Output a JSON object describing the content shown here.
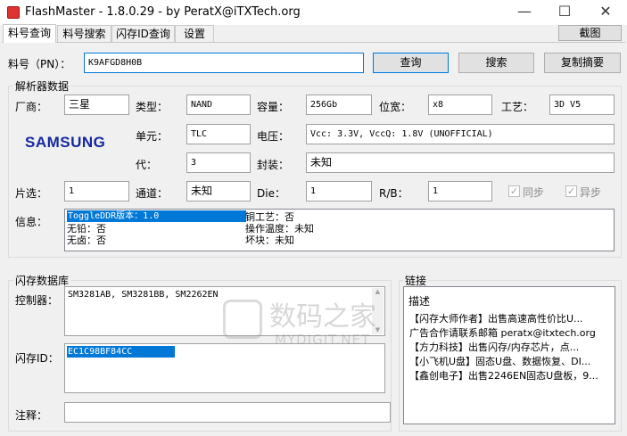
{
  "window": {
    "title": "FlashMaster - 1.8.0.29 - by PeratX@iTXTech.org",
    "minimize": "—",
    "maximize": "☐",
    "close": "✕"
  },
  "tabs": [
    "料号查询",
    "料号搜索",
    "闪存ID查询",
    "设置"
  ],
  "toolbar": {
    "screenshot_label": "截图"
  },
  "query": {
    "pn_label": "料号（PN）：",
    "pn_value": "K9AFGD8H0B",
    "query_button": "查询",
    "search_button": "搜索",
    "copy_summary_button": "复制摘要"
  },
  "parser": {
    "group_title": "解析器数据",
    "vendor_label": "厂商：",
    "vendor_value": "三星",
    "type_label": "类型：",
    "type_value": "NAND",
    "capacity_label": "容量：",
    "capacity_value": "256Gb",
    "width_label": "位宽：",
    "width_value": "x8",
    "process_label": "工艺：",
    "process_value": "3D V5",
    "logo_text": "SAMSUNG",
    "cell_label": "单元：",
    "cell_value": "TLC",
    "voltage_label": "电压：",
    "voltage_value": "Vcc: 3.3V, VccQ: 1.8V (UNOFFICIAL)",
    "gen_label": "代：",
    "gen_value": "3",
    "package_label": "封装：",
    "package_value": "未知",
    "ce_label": "片选：",
    "ce_value": "1",
    "channel_label": "通道：",
    "channel_value": "未知",
    "die_label": "Die：",
    "die_value": "1",
    "rb_label": "R/B：",
    "rb_value": "1",
    "sync_label": "同步",
    "async_label": "异步",
    "info_label": "信息：",
    "info_lines": {
      "l1a": "ToggleDDR版本：1.0",
      "l1b": "铜工艺：否",
      "l2a": "无铅：否",
      "l2b": "操作温度：未知",
      "l3a": "无卤：否",
      "l3b": "坏块：未知"
    }
  },
  "flashdb": {
    "group_title": "闪存数据库",
    "controller_label": "控制器：",
    "controller_value": "SM3281AB, SM3281BB, SM2262EN",
    "flashid_label": "闪存ID：",
    "flashid_value": "EC1C98BF84CC",
    "note_label": "注释：",
    "note_value": ""
  },
  "links": {
    "group_title": "链接",
    "header": "描述",
    "items": [
      "【闪存大师作者】出售高速高性价比U...",
      "广告合作请联系邮箱 peratx@itxtech.org",
      "【方力科技】出售闪存/内存芯片，点...",
      "【小飞机U盘】固态U盘、数据恢复、DI...",
      "【鑫创电子】出售2246EN固态U盘板，9..."
    ]
  },
  "watermark": {
    "line1": "数码之家",
    "line2": "MYDIGIT.NET"
  },
  "colors": {
    "selection": "#0078d7",
    "samsung_blue": "#1428a0"
  }
}
